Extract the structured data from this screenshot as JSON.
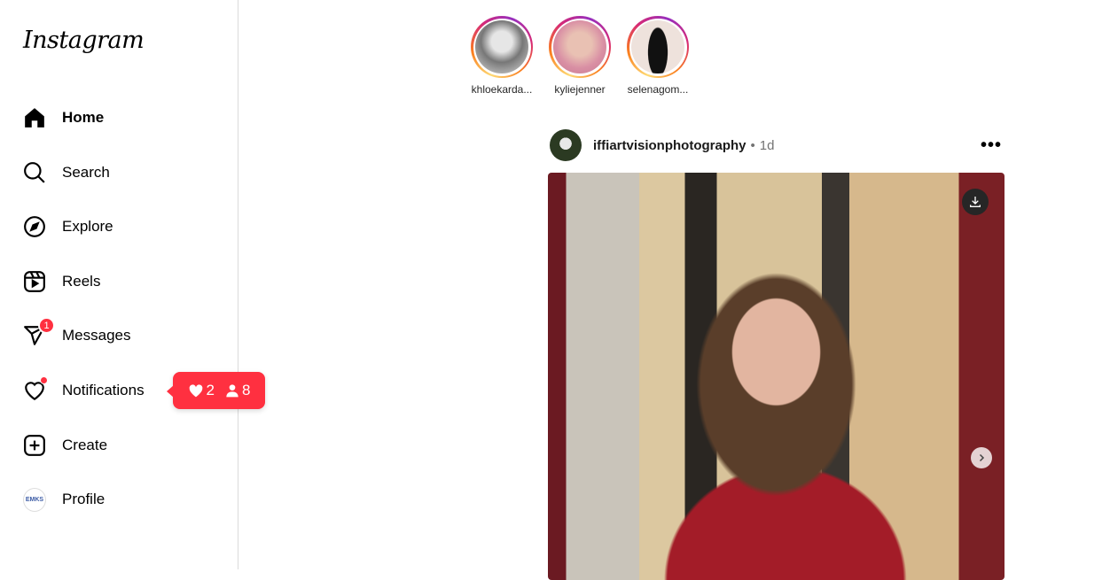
{
  "brand": {
    "logo": "Instagram"
  },
  "sidebar": {
    "items": [
      {
        "label": "Home",
        "icon": "home-icon"
      },
      {
        "label": "Search",
        "icon": "search-icon"
      },
      {
        "label": "Explore",
        "icon": "compass-icon"
      },
      {
        "label": "Reels",
        "icon": "reels-icon"
      },
      {
        "label": "Messages",
        "icon": "messenger-icon",
        "badge": "1"
      },
      {
        "label": "Notifications",
        "icon": "heart-icon"
      },
      {
        "label": "Create",
        "icon": "plus-square-icon"
      },
      {
        "label": "Profile",
        "icon": "avatar",
        "avatar_text": "EMKS"
      }
    ]
  },
  "notification_tooltip": {
    "likes": "2",
    "follows": "8",
    "color": "#ff3040"
  },
  "stories": [
    {
      "username": "khloekarda..."
    },
    {
      "username": "kyliejenner"
    },
    {
      "username": "selenagom..."
    }
  ],
  "post": {
    "username": "iffiartvisionphotography",
    "separator": "•",
    "time": "1d",
    "more": "•••"
  }
}
